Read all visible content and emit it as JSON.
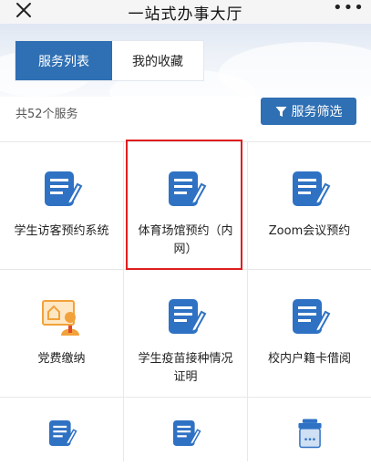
{
  "header": {
    "title": "一站式办事大厅",
    "more": "•••"
  },
  "tabs": [
    {
      "label": "服务列表",
      "active": true
    },
    {
      "label": "我的收藏",
      "active": false
    }
  ],
  "toolbar": {
    "count_text": "共52个服务",
    "filter_label": "服务筛选"
  },
  "services": [
    {
      "label": "学生访客预约系统",
      "icon": "document-edit-icon"
    },
    {
      "label": "体育场馆预约（内网）",
      "icon": "document-edit-icon"
    },
    {
      "label": "Zoom会议预约",
      "icon": "document-edit-icon"
    },
    {
      "label": "党费缴纳",
      "icon": "party-fee-certificate-icon"
    },
    {
      "label": "学生疫苗接种情况证明",
      "icon": "document-edit-icon"
    },
    {
      "label": "校内户籍卡借阅",
      "icon": "document-edit-icon"
    },
    {
      "label": "",
      "icon": "document-edit-icon"
    },
    {
      "label": "",
      "icon": "document-edit-icon"
    },
    {
      "label": "",
      "icon": "card-reader-icon"
    }
  ],
  "colors": {
    "primary": "#2f6fb3",
    "icon_blue": "#2f72c4",
    "icon_orange": "#f2a23a",
    "highlight": "#e01e1e"
  }
}
